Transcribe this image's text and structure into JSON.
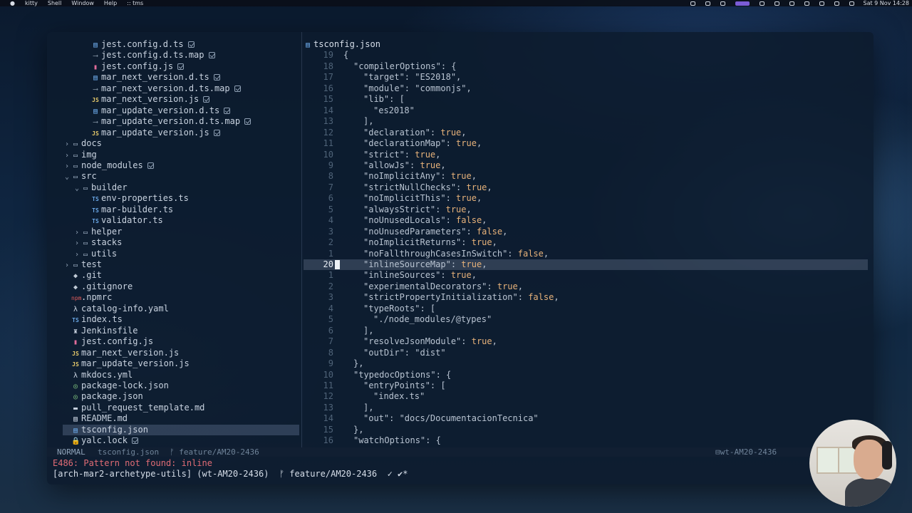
{
  "menubar": {
    "items": [
      "kitty",
      "Shell",
      "Window",
      "Help",
      ":: tms"
    ],
    "clock": "Sat 9 Nov 14:28"
  },
  "tree": [
    {
      "indent": 2,
      "chev": "",
      "icon": "dts",
      "glyph": "▤",
      "label": "jest.config.d.ts",
      "check": true
    },
    {
      "indent": 2,
      "chev": "",
      "icon": "map",
      "glyph": "⟶",
      "label": "jest.config.d.ts.map",
      "check": true
    },
    {
      "indent": 2,
      "chev": "",
      "icon": "jsr",
      "glyph": "▮",
      "label": "jest.config.js",
      "check": true
    },
    {
      "indent": 2,
      "chev": "",
      "icon": "dts",
      "glyph": "▤",
      "label": "mar_next_version.d.ts",
      "check": true
    },
    {
      "indent": 2,
      "chev": "",
      "icon": "map",
      "glyph": "⟶",
      "label": "mar_next_version.d.ts.map",
      "check": true
    },
    {
      "indent": 2,
      "chev": "",
      "icon": "js",
      "glyph": "JS",
      "label": "mar_next_version.js",
      "check": true
    },
    {
      "indent": 2,
      "chev": "",
      "icon": "dts",
      "glyph": "▤",
      "label": "mar_update_version.d.ts",
      "check": true
    },
    {
      "indent": 2,
      "chev": "",
      "icon": "map",
      "glyph": "⟶",
      "label": "mar_update_version.d.ts.map",
      "check": true
    },
    {
      "indent": 2,
      "chev": "",
      "icon": "js",
      "glyph": "JS",
      "label": "mar_update_version.js",
      "check": true
    },
    {
      "indent": 0,
      "chev": "›",
      "icon": "fold",
      "glyph": "▭",
      "label": "docs",
      "check": false
    },
    {
      "indent": 0,
      "chev": "›",
      "icon": "fold",
      "glyph": "▭",
      "label": "img",
      "check": false
    },
    {
      "indent": 0,
      "chev": "›",
      "icon": "fold",
      "glyph": "▭",
      "label": "node_modules",
      "check": true
    },
    {
      "indent": 0,
      "chev": "⌄",
      "icon": "fold",
      "glyph": "▭",
      "label": "src",
      "check": false
    },
    {
      "indent": 1,
      "chev": "⌄",
      "icon": "fold",
      "glyph": "▭",
      "label": "builder",
      "check": false
    },
    {
      "indent": 2,
      "chev": "",
      "icon": "ts",
      "glyph": "TS",
      "label": "env-properties.ts",
      "check": false
    },
    {
      "indent": 2,
      "chev": "",
      "icon": "ts",
      "glyph": "TS",
      "label": "mar-builder.ts",
      "check": false
    },
    {
      "indent": 2,
      "chev": "",
      "icon": "ts",
      "glyph": "TS",
      "label": "validator.ts",
      "check": false
    },
    {
      "indent": 1,
      "chev": "›",
      "icon": "fold",
      "glyph": "▭",
      "label": "helper",
      "check": false
    },
    {
      "indent": 1,
      "chev": "›",
      "icon": "fold",
      "glyph": "▭",
      "label": "stacks",
      "check": false
    },
    {
      "indent": 1,
      "chev": "›",
      "icon": "fold",
      "glyph": "▭",
      "label": "utils",
      "check": false
    },
    {
      "indent": 0,
      "chev": "›",
      "icon": "fold",
      "glyph": "▭",
      "label": "test",
      "check": false
    },
    {
      "indent": 0,
      "chev": "",
      "icon": "git",
      "glyph": "◆",
      "label": ".git",
      "check": false
    },
    {
      "indent": 0,
      "chev": "",
      "icon": "git",
      "glyph": "◆",
      "label": ".gitignore",
      "check": false
    },
    {
      "indent": 0,
      "chev": "",
      "icon": "npm",
      "glyph": "npm",
      "label": ".npmrc",
      "check": false
    },
    {
      "indent": 0,
      "chev": "",
      "icon": "yaml",
      "glyph": "λ",
      "label": "catalog-info.yaml",
      "check": false
    },
    {
      "indent": 0,
      "chev": "",
      "icon": "ts",
      "glyph": "TS",
      "label": "index.ts",
      "check": false
    },
    {
      "indent": 0,
      "chev": "",
      "icon": "lock",
      "glyph": "♜",
      "label": "Jenkinsfile",
      "check": false
    },
    {
      "indent": 0,
      "chev": "",
      "icon": "jsr",
      "glyph": "▮",
      "label": "jest.config.js",
      "check": false
    },
    {
      "indent": 0,
      "chev": "",
      "icon": "js",
      "glyph": "JS",
      "label": "mar_next_version.js",
      "check": false
    },
    {
      "indent": 0,
      "chev": "",
      "icon": "js",
      "glyph": "JS",
      "label": "mar_update_version.js",
      "check": false
    },
    {
      "indent": 0,
      "chev": "",
      "icon": "yaml",
      "glyph": "λ",
      "label": "mkdocs.yml",
      "check": false
    },
    {
      "indent": 0,
      "chev": "",
      "icon": "json",
      "glyph": "◎",
      "label": "package-lock.json",
      "check": false
    },
    {
      "indent": 0,
      "chev": "",
      "icon": "json",
      "glyph": "◎",
      "label": "package.json",
      "check": false
    },
    {
      "indent": 0,
      "chev": "",
      "icon": "md",
      "glyph": "▬",
      "label": "pull_request_template.md",
      "check": false
    },
    {
      "indent": 0,
      "chev": "",
      "icon": "md",
      "glyph": "▤",
      "label": "README.md",
      "check": false
    },
    {
      "indent": 0,
      "chev": "",
      "icon": "dts",
      "glyph": "▤",
      "label": "tsconfig.json",
      "check": false,
      "selected": true
    },
    {
      "indent": 0,
      "chev": "",
      "icon": "lock",
      "glyph": "🔒",
      "label": "yalc.lock",
      "check": true
    }
  ],
  "editor": {
    "tab": "tsconfig.json",
    "lines": [
      {
        "n": "19",
        "t": "{",
        "d": 0
      },
      {
        "n": "18",
        "t": "\"compilerOptions\": {",
        "d": 1
      },
      {
        "n": "17",
        "t": "\"target\": \"ES2018\",",
        "d": 2
      },
      {
        "n": "16",
        "t": "\"module\": \"commonjs\",",
        "d": 2
      },
      {
        "n": "15",
        "t": "\"lib\": [",
        "d": 2
      },
      {
        "n": "14",
        "t": "\"es2018\"",
        "d": 3
      },
      {
        "n": "13",
        "t": "],",
        "d": 2
      },
      {
        "n": "12",
        "t": "\"declaration\": true,",
        "d": 2
      },
      {
        "n": "11",
        "t": "\"declarationMap\": true,",
        "d": 2
      },
      {
        "n": "10",
        "t": "\"strict\": true,",
        "d": 2
      },
      {
        "n": "9",
        "t": "\"allowJs\": true,",
        "d": 2
      },
      {
        "n": "8",
        "t": "\"noImplicitAny\": true,",
        "d": 2
      },
      {
        "n": "7",
        "t": "\"strictNullChecks\": true,",
        "d": 2
      },
      {
        "n": "6",
        "t": "\"noImplicitThis\": true,",
        "d": 2
      },
      {
        "n": "5",
        "t": "\"alwaysStrict\": true,",
        "d": 2
      },
      {
        "n": "4",
        "t": "\"noUnusedLocals\": false,",
        "d": 2
      },
      {
        "n": "3",
        "t": "\"noUnusedParameters\": false,",
        "d": 2
      },
      {
        "n": "2",
        "t": "\"noImplicitReturns\": true,",
        "d": 2
      },
      {
        "n": "1",
        "t": "\"noFallthroughCasesInSwitch\": false,",
        "d": 2
      },
      {
        "n": "20",
        "t": "\"inlineSourceMap\": true,",
        "d": 2,
        "current": true
      },
      {
        "n": "1",
        "t": "\"inlineSources\": true,",
        "d": 2
      },
      {
        "n": "2",
        "t": "\"experimentalDecorators\": true,",
        "d": 2
      },
      {
        "n": "3",
        "t": "\"strictPropertyInitialization\": false,",
        "d": 2
      },
      {
        "n": "4",
        "t": "\"typeRoots\": [",
        "d": 2
      },
      {
        "n": "5",
        "t": "\"./node_modules/@types\"",
        "d": 3
      },
      {
        "n": "6",
        "t": "],",
        "d": 2
      },
      {
        "n": "7",
        "t": "\"resolveJsonModule\": true,",
        "d": 2
      },
      {
        "n": "8",
        "t": "\"outDir\": \"dist\"",
        "d": 2
      },
      {
        "n": "9",
        "t": "},",
        "d": 1
      },
      {
        "n": "10",
        "t": "\"typedocOptions\": {",
        "d": 1
      },
      {
        "n": "11",
        "t": "\"entryPoints\": [",
        "d": 2
      },
      {
        "n": "12",
        "t": "\"index.ts\"",
        "d": 3
      },
      {
        "n": "13",
        "t": "],",
        "d": 2
      },
      {
        "n": "14",
        "t": "\"out\": \"docs/DocumentacionTecnica\"",
        "d": 2
      },
      {
        "n": "15",
        "t": "},",
        "d": 1
      },
      {
        "n": "16",
        "t": "\"watchOptions\": {",
        "d": 1
      }
    ]
  },
  "statusline": {
    "mode": "NORMAL",
    "file": "tsconfig.json",
    "branch": "ᚠ feature/AM20-2436",
    "worktree": "⊟wt-AM20-2436"
  },
  "message": "E486: Pattern not found: inline",
  "prompt": {
    "text": "[arch-mar2-archetype-utils] (wt-AM20-2436)  ᚠ feature/AM20-2436  ✓ ✔*"
  },
  "colors": {
    "accent": "#7b5cd6",
    "error": "#e06c75",
    "boolean": "#e7b27a",
    "selection": "#3c4a5e"
  }
}
